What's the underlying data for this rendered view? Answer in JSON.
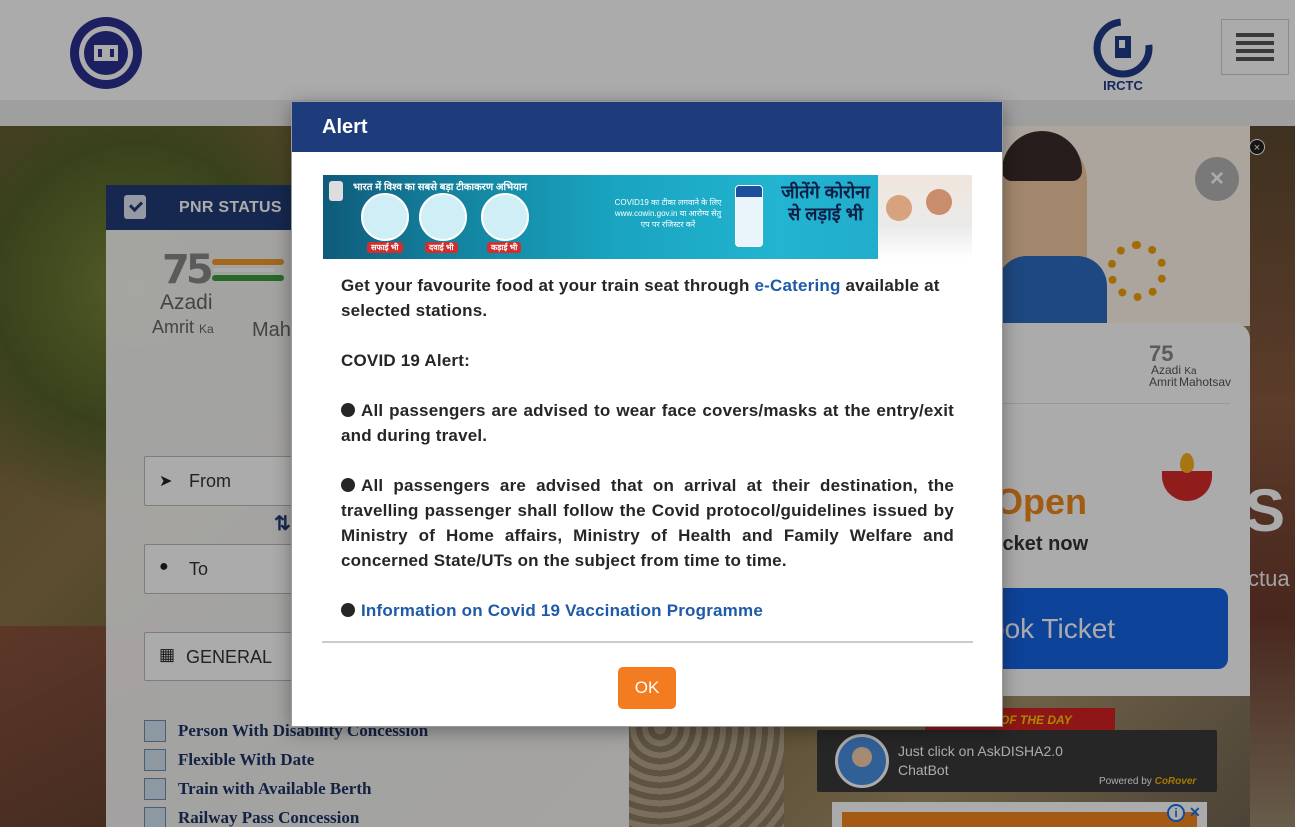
{
  "header": {
    "irctc_logo_text": "IRCTC",
    "indian_railways_logo": "indian-railways-emblem",
    "menu_icon": "hamburger-icon"
  },
  "booking_form": {
    "tab_title": "PNR STATUS",
    "azadi_logo": {
      "number": "75",
      "line1": "Azadi",
      "line2_a": "Amrit",
      "line2_b": "Ka",
      "line3": "Mahots"
    },
    "from_placeholder": "From",
    "to_placeholder": "To",
    "class_label": "GENERAL",
    "concessions": [
      "Person With Disability Concession",
      "Flexible With Date",
      "Train with Available Berth",
      "Railway Pass Concession"
    ]
  },
  "right_panel": {
    "azadi_small": {
      "number": "75",
      "line1": "Azadi",
      "line2": "Ka",
      "line3a": "Amrit",
      "line3b": "Mahotsav"
    },
    "promo_open": "Open",
    "promo_ticket_now": "icket now",
    "book_ticket_btn": "ook Ticket",
    "deal_tag": "OF THE DAY",
    "chatbot_line1": "Just click on AskDISHA2.0",
    "chatbot_line2": "ChatBot",
    "chatbot_powered": "Powered by",
    "chatbot_powered_brand": "CoRover",
    "edge_letter": "S",
    "edge_text": "ctua"
  },
  "modal": {
    "title": "Alert",
    "banner": {
      "headline": "भारत में विश्व का सबसे बड़ा टीकाकरण अभियान",
      "captions": [
        "सफाई भी",
        "दवाई भी",
        "कड़ाई भी"
      ],
      "middle_text": "COVID19 का टीका लगवाने के लिए www.cowin.gov.in या आरोग्य सेतु एप पर रजिस्टर करें",
      "slogan": "जीतेंगे कोरोना से लड़ाई भी"
    },
    "para1_before": "Get your favourite food at your train seat through ",
    "para1_link": "e-Catering",
    "para1_after": " available at selected stations.",
    "covid_heading": "COVID 19 Alert:",
    "bullet1": "All passengers are advised to wear face covers/masks at the entry/exit and during travel.",
    "bullet2": "All passengers are advised that on arrival at their destination, the travelling passenger shall follow the Covid protocol/guidelines issued by Ministry of Home affairs, Ministry of Health and Family Welfare and concerned State/UTs on the subject from time to time.",
    "bullet3_link": "Information on Covid 19 Vaccination Programme",
    "ok_label": "OK"
  },
  "colors": {
    "modal_header": "#1e3c7c",
    "link": "#1e5aa8",
    "ok_button": "#f47c20",
    "form_header": "#213d77"
  }
}
